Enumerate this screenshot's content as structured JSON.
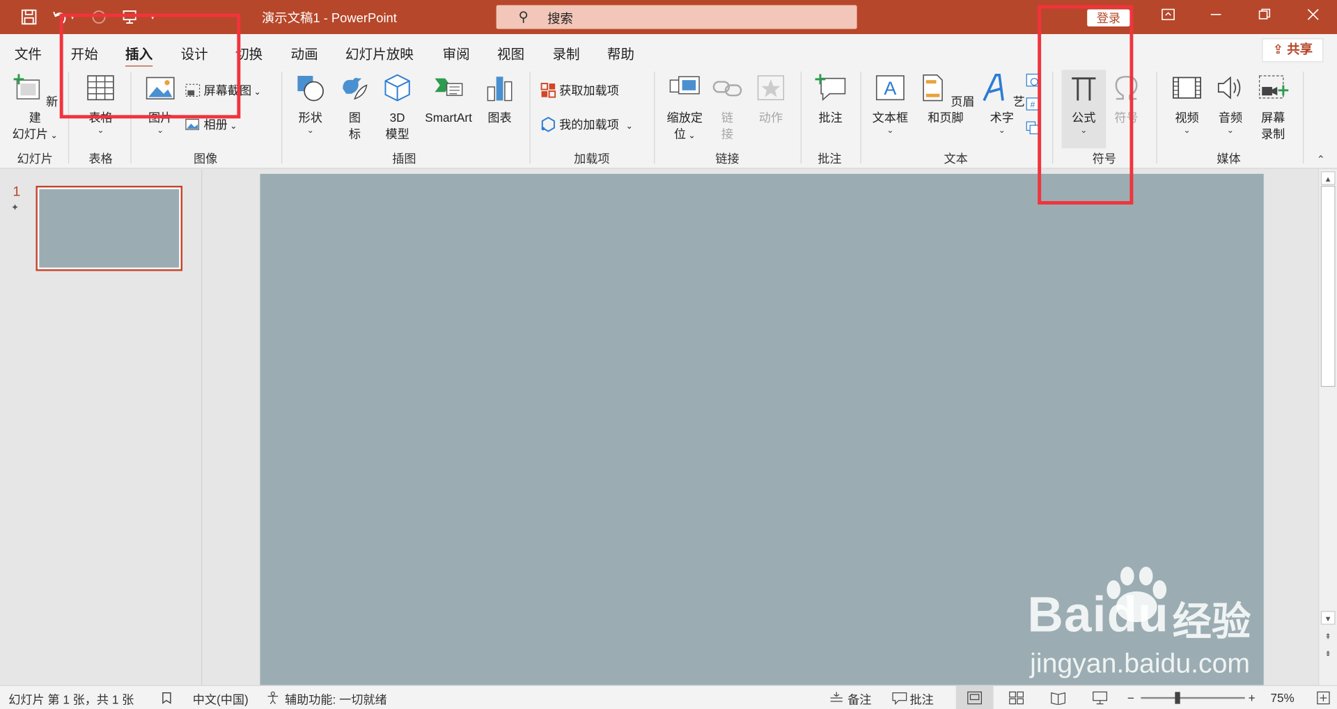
{
  "window": {
    "title": "演示文稿1  -  PowerPoint",
    "search_placeholder": "搜索",
    "signin": "登录"
  },
  "tabs": [
    "文件",
    "开始",
    "插入",
    "设计",
    "切换",
    "动画",
    "幻灯片放映",
    "审阅",
    "视图",
    "录制",
    "帮助"
  ],
  "share": "共享",
  "ribbon": {
    "slides": {
      "new_slide_1": "新建",
      "new_slide_2": "幻灯片",
      "group": "幻灯片"
    },
    "tables": {
      "table": "表格",
      "group": "表格"
    },
    "images": {
      "pictures": "图片",
      "screenshot": "屏幕截图",
      "album": "相册",
      "group": "图像"
    },
    "illustrations": {
      "shapes": "形状",
      "icons_1": "图",
      "icons_2": "标",
      "model_1": "3D",
      "model_2": "模型",
      "smartart": "SmartArt",
      "chart": "图表",
      "group": "插图"
    },
    "addins": {
      "get": "获取加载项",
      "mine": "我的加载项",
      "group": "加载项"
    },
    "links": {
      "zoom_1": "缩放定",
      "zoom_2": "位",
      "link_1": "链",
      "link_2": "接",
      "action": "动作",
      "group": "链接"
    },
    "comments": {
      "comment": "批注",
      "group": "批注"
    },
    "text": {
      "textbox": "文本框",
      "header": "页眉和页脚",
      "wordart": "艺术字",
      "group": "文本"
    },
    "symbols": {
      "equation": "公式",
      "symbol": "符号",
      "group": "符号"
    },
    "media": {
      "video": "视频",
      "audio": "音频",
      "rec_1": "屏幕",
      "rec_2": "录制",
      "group": "媒体"
    }
  },
  "slides_panel": {
    "number": "1"
  },
  "status": {
    "slide_info": "幻灯片 第 1 张，共 1 张",
    "language": "中文(中国)",
    "accessibility": "辅助功能: 一切就绪",
    "notes": "备注",
    "comments": "批注",
    "zoom": "75%"
  },
  "watermark": {
    "brand": "Baidu",
    "suffix": "经验",
    "url": "jingyan.baidu.com"
  },
  "colors": {
    "accent": "#b7472a",
    "slide_bg": "#9badb2",
    "annotation": "#f0343c"
  }
}
